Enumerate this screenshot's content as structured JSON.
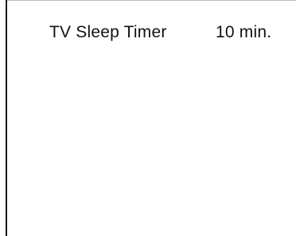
{
  "menu": {
    "item_label": "TV Sleep Timer",
    "item_value": "10 min."
  }
}
